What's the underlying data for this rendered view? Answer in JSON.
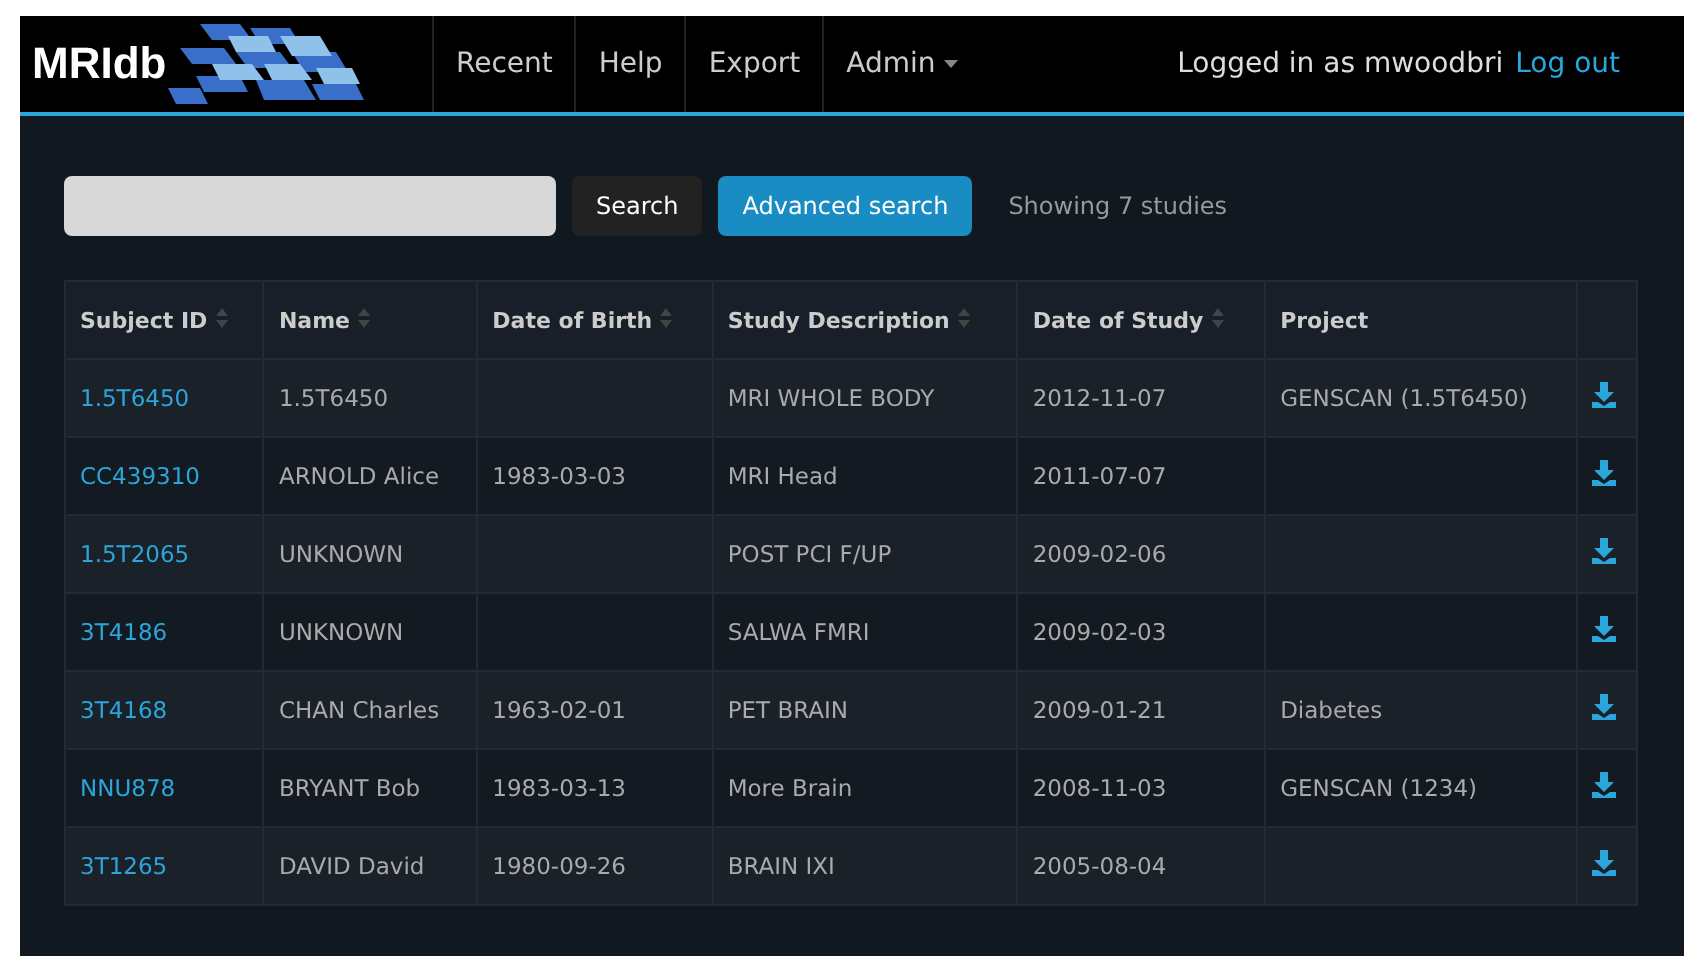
{
  "navbar": {
    "brand": "MRIdb",
    "links": [
      {
        "label": "Recent",
        "kind": "link"
      },
      {
        "label": "Help",
        "kind": "link"
      },
      {
        "label": "Export",
        "kind": "link"
      },
      {
        "label": "Admin",
        "kind": "dropdown"
      }
    ],
    "user_text": "Logged in as mwoodbri",
    "logout": "Log out"
  },
  "toolbar": {
    "search_button": "Search",
    "advanced_button": "Advanced search",
    "count": "Showing 7 studies"
  },
  "table": {
    "columns": [
      {
        "label": "Subject ID",
        "sortable": true
      },
      {
        "label": "Name",
        "sortable": true
      },
      {
        "label": "Date of Birth",
        "sortable": true
      },
      {
        "label": "Study Description",
        "sortable": true
      },
      {
        "label": "Date of Study",
        "sortable": true
      },
      {
        "label": "Project",
        "sortable": false
      }
    ],
    "rows": [
      {
        "cells": [
          "1.5T6450",
          "1.5T6450",
          "",
          "MRI WHOLE BODY",
          "2012-11-07",
          "GENSCAN (1.5T6450)"
        ]
      },
      {
        "cells": [
          "CC439310",
          "ARNOLD Alice",
          "1983-03-03",
          "MRI Head",
          "2011-07-07",
          ""
        ]
      },
      {
        "cells": [
          "1.5T2065",
          "UNKNOWN",
          "",
          "POST PCI F/UP",
          "2009-02-06",
          ""
        ]
      },
      {
        "cells": [
          "3T4186",
          "UNKNOWN",
          "",
          "SALWA FMRI",
          "2009-02-03",
          ""
        ]
      },
      {
        "cells": [
          "3T4168",
          "CHAN Charles",
          "1963-02-01",
          "PET BRAIN",
          "2009-01-21",
          "Diabetes"
        ]
      },
      {
        "cells": [
          "NNU878",
          "BRYANT Bob",
          "1983-03-13",
          "More Brain",
          "2008-11-03",
          "GENSCAN (1234)"
        ]
      },
      {
        "cells": [
          "3T1265",
          "DAVID David",
          "1980-09-26",
          "BRAIN IXI",
          "2005-08-04",
          ""
        ]
      }
    ]
  }
}
